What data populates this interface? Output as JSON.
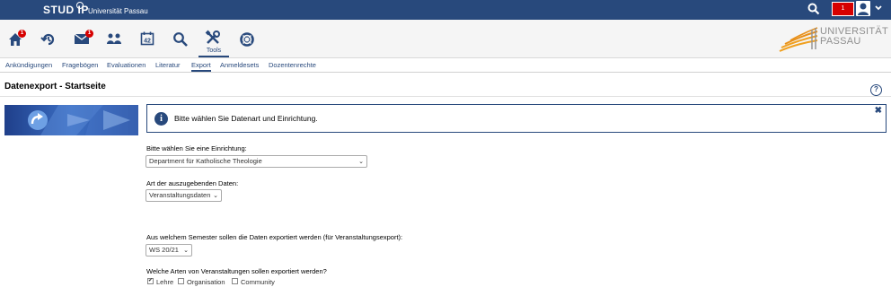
{
  "topbar": {
    "logo_text": "STUD IP",
    "university": "Universität Passau",
    "notification_count": "1",
    "icons": [
      "search-icon",
      "user-icon",
      "chevron-down-icon"
    ]
  },
  "nav": {
    "home_badge": "1",
    "messages_badge": "1",
    "tools_label": "Tools",
    "icons": [
      "home-icon",
      "activity-icon",
      "mail-icon",
      "community-icon",
      "calendar-icon",
      "search-icon",
      "tools-icon",
      "lifebuoy-icon"
    ]
  },
  "uni_logo": {
    "line1": "UNIVERSITÄT",
    "line2": "PASSAU"
  },
  "tabs": [
    {
      "label": "Ankündigungen"
    },
    {
      "label": "Fragebögen"
    },
    {
      "label": "Evaluationen"
    },
    {
      "label": "Literatur"
    },
    {
      "label": "Export"
    },
    {
      "label": "Anmeldesets"
    },
    {
      "label": "Dozentenrechte"
    }
  ],
  "active_tab": "Export",
  "page": {
    "title": "Datenexport - Startseite",
    "help": "?"
  },
  "info": {
    "message": "Bitte wählen Sie Datenart und Einrichtung.",
    "close": "✖"
  },
  "form": {
    "institution_label": "Bitte wählen Sie eine Einrichtung:",
    "institution_value": "Department für Katholische Theologie",
    "datatype_label": "Art der auszugebenden Daten:",
    "datatype_value": "Veranstaltungsdaten",
    "semester_label": "Aus welchem Semester sollen die Daten exportiert werden (für Veranstaltungsexport):",
    "semester_value": "WS 20/21",
    "types_label": "Welche Arten von Veranstaltungen sollen exportiert werden?",
    "types": [
      {
        "label": "Lehre",
        "checked": true
      },
      {
        "label": "Organisation",
        "checked": false
      },
      {
        "label": "Community",
        "checked": false
      }
    ]
  },
  "colors": {
    "brand": "#28497c",
    "alert": "#d60000",
    "logo_orange": "#f0a020"
  }
}
